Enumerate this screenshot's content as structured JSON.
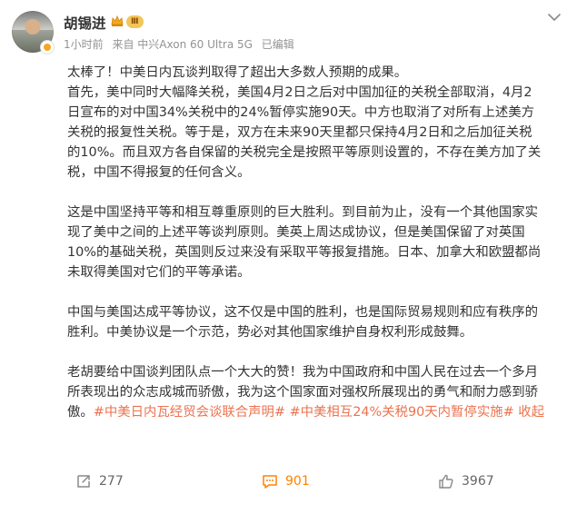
{
  "author": {
    "name": "胡锡进",
    "vip_label": "Ⅲ"
  },
  "meta": {
    "time": "1小时前",
    "source": "来自 中兴Axon 60 Ultra 5G",
    "edited": "已编辑"
  },
  "post": {
    "p1_line1": "太棒了！中美日内瓦谈判取得了超出大多数人预期的成果。",
    "p1_line2": "首先，美中同时大幅降关税，美国4月2日之后对中国加征的关税全部取消，4月2",
    "p1_line3": "日宣布的对中国34%关税中的24%暂停实施90天。中方也取消了对所有上述美方",
    "p1_line4": "关税的报复性关税。等于是，双方在未来90天里都只保持4月2日和之后加征关税",
    "p1_line5": "的10%。而且双方各自保留的关税完全是按照平等原则设置的，不存在美方加了关",
    "p1_line6": "税，中国不得报复的任何含义。",
    "p2_line1": "这是中国坚持平等和相互尊重原则的巨大胜利。到目前为止，没有一个其他国家实",
    "p2_line2": "现了美中之间的上述平等谈判原则。美英上周达成协议，但是美国保留了对英国",
    "p2_line3": "10%的基础关税，英国则反过来没有采取平等报复措施。日本、加拿大和欧盟都尚",
    "p2_line4": "未取得美国对它们的平等承诺。",
    "p3_line1": "中国与美国达成平等协议，这不仅是中国的胜利，也是国际贸易规则和应有秩序的",
    "p3_line2": "胜利。中美协议是一个示范，势必对其他国家维护自身权利形成鼓舞。",
    "p4_line1": "老胡要给中国谈判团队点一个大大的赞！我为中国政府和中国人民在过去一个多月",
    "p4_line2": "所表现出的众志成城而骄傲，我为这个国家面对强权所展现出的勇气和耐力感到骄",
    "p4_line3_text": "傲。",
    "hashtag1": "#中美日内瓦经贸会谈联合声明#",
    "hashtag2": "#中美相互24%关税90天内暂停实施#",
    "collapse": "收起"
  },
  "actions": {
    "repost_count": "277",
    "comment_count": "901",
    "like_count": "3967"
  },
  "colors": {
    "accent": "#eb7350",
    "comment_highlight": "#ff8200",
    "meta_gray": "#939393"
  },
  "icons": {
    "more": "chevron-down-icon",
    "repost": "repost-icon",
    "comment": "comment-icon",
    "like": "like-icon",
    "crown": "crown-icon"
  }
}
